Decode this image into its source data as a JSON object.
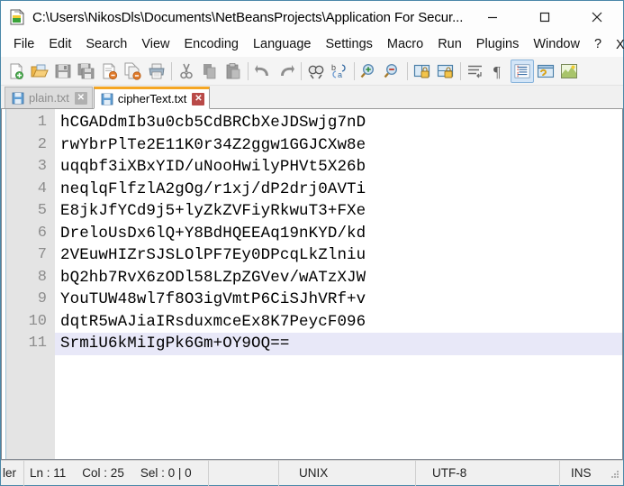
{
  "window": {
    "title": "C:\\Users\\NikosDls\\Documents\\NetBeansProjects\\Application For Secur...",
    "app_icon": "notepad-plus-plus-icon",
    "minimize_label": "—",
    "maximize_label": "□",
    "close_label": "✕",
    "accent_color": "#4a87a8"
  },
  "menubar": {
    "items": [
      {
        "label": "File",
        "name": "menu-file"
      },
      {
        "label": "Edit",
        "name": "menu-edit"
      },
      {
        "label": "Search",
        "name": "menu-search"
      },
      {
        "label": "View",
        "name": "menu-view"
      },
      {
        "label": "Encoding",
        "name": "menu-encoding"
      },
      {
        "label": "Language",
        "name": "menu-language"
      },
      {
        "label": "Settings",
        "name": "menu-settings"
      },
      {
        "label": "Macro",
        "name": "menu-macro"
      },
      {
        "label": "Run",
        "name": "menu-run"
      },
      {
        "label": "Plugins",
        "name": "menu-plugins"
      },
      {
        "label": "Window",
        "name": "menu-window"
      },
      {
        "label": "?",
        "name": "menu-help"
      }
    ],
    "close_document_label": "X"
  },
  "toolbar": {
    "buttons": [
      {
        "name": "new-file-icon",
        "title": "New"
      },
      {
        "name": "open-file-icon",
        "title": "Open"
      },
      {
        "name": "save-icon",
        "title": "Save"
      },
      {
        "name": "save-all-icon",
        "title": "Save All"
      },
      {
        "name": "close-file-icon",
        "title": "Close"
      },
      {
        "name": "close-all-files-icon",
        "title": "Close All"
      },
      {
        "name": "print-icon",
        "title": "Print"
      },
      {
        "name": "cut-icon",
        "title": "Cut"
      },
      {
        "name": "copy-icon",
        "title": "Copy"
      },
      {
        "name": "paste-icon",
        "title": "Paste"
      },
      {
        "name": "undo-icon",
        "title": "Undo"
      },
      {
        "name": "redo-icon",
        "title": "Redo"
      },
      {
        "name": "find-icon",
        "title": "Find"
      },
      {
        "name": "replace-icon",
        "title": "Replace"
      },
      {
        "name": "zoom-in-icon",
        "title": "Zoom In"
      },
      {
        "name": "zoom-out-icon",
        "title": "Zoom Out"
      },
      {
        "name": "sync-vertical-scroll-icon",
        "title": "Synchronize Vertical Scrolling"
      },
      {
        "name": "sync-horizontal-scroll-icon",
        "title": "Synchronize Horizontal Scrolling"
      },
      {
        "name": "word-wrap-icon",
        "title": "Word Wrap"
      },
      {
        "name": "show-all-characters-icon",
        "title": "Show All Characters"
      },
      {
        "name": "indent-guide-icon",
        "title": "Show Indent Guide"
      },
      {
        "name": "user-defined-dialog-icon",
        "title": "User Defined Dialogue"
      },
      {
        "name": "document-map-icon",
        "title": "Document Map"
      }
    ],
    "active_button": "indent-guide-icon"
  },
  "tabs": [
    {
      "label": "plain.txt",
      "active": false,
      "name": "tab-plain-txt",
      "close_label": "✕"
    },
    {
      "label": "cipherText.txt",
      "active": true,
      "name": "tab-ciphertext-txt",
      "close_label": "✕"
    }
  ],
  "editor": {
    "current_line_index": 10,
    "line_numbers": [
      "1",
      "2",
      "3",
      "4",
      "5",
      "6",
      "7",
      "8",
      "9",
      "10",
      "11"
    ],
    "lines": [
      "hCGADdmIb3u0cb5CdBRCbXeJDSwjg7nD",
      "rwYbrPlTe2E11K0r34Z2ggw1GGJCXw8e",
      "uqqbf3iXBxYID/uNooHwilyPHVt5X26b",
      "neqlqFlfzlA2gOg/r1xj/dP2drj0AVTi",
      "E8jkJfYCd9j5+lyZkZVFiyRkwuT3+FXe",
      "DreloUsDx6lQ+Y8BdHQEEAq19nKYD/kd",
      "2VEuwHIZrSJSLOlPF7Ey0DPcqLkZlniu",
      "bQ2hb7RvX6zODl58LZpZGVev/wATzXJW",
      "YouTUW48wl7f8O3igVmtP6CiSJhVRf+v",
      "dqtR5wAJiaIRsduxmceEx8K7PeycF096",
      "SrmiU6kMiIgPk6Gm+OY9OQ=="
    ],
    "current_line_highlight_color": "#e8e8f8"
  },
  "statusbar": {
    "doc_type": "ler",
    "line": "Ln : 11",
    "column": "Col : 25",
    "selection": "Sel : 0 | 0",
    "eol": "UNIX",
    "encoding": "UTF-8",
    "insert_mode": "INS"
  }
}
